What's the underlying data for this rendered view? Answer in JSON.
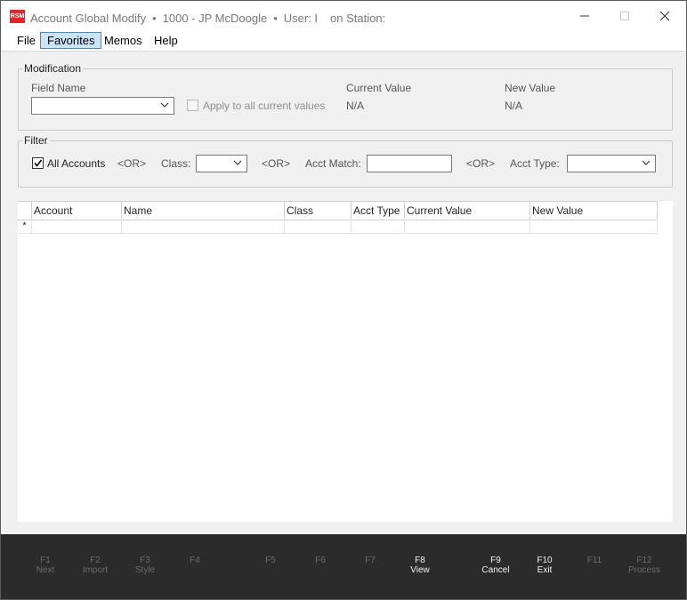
{
  "window": {
    "app_name": "Account Global Modify",
    "separator": "•",
    "client": "1000 - JP McDoogle",
    "user_label": "User: I",
    "station_label": "on Station:"
  },
  "menu": [
    "File",
    "Favorites",
    "Memos",
    "Help"
  ],
  "modification": {
    "legend": "Modification",
    "field_name_label": "Field Name",
    "field_name_value": "",
    "apply_all_label": "Apply to all current values",
    "current_value_label": "Current Value",
    "current_value": "N/A",
    "new_value_label": "New Value",
    "new_value": "N/A"
  },
  "filter": {
    "legend": "Filter",
    "all_accounts_label": "All Accounts",
    "all_accounts_checked": true,
    "or_text": "<OR>",
    "class_label": "Class:",
    "class_value": "",
    "acct_match_label": "Acct Match:",
    "acct_match_value": "",
    "acct_type_label": "Acct Type:",
    "acct_type_value": ""
  },
  "grid": {
    "columns": [
      "Account",
      "Name",
      "Class",
      "Acct Type",
      "Current Value",
      "New Value"
    ],
    "new_row_marker": "*"
  },
  "function_keys": [
    {
      "key": "F1",
      "label": "Next",
      "enabled": false
    },
    {
      "key": "F2",
      "label": "Import",
      "enabled": false
    },
    {
      "key": "F3",
      "label": "Style",
      "enabled": false
    },
    {
      "key": "F4",
      "label": "",
      "enabled": false
    },
    {
      "key": "F5",
      "label": "",
      "enabled": false
    },
    {
      "key": "F6",
      "label": "",
      "enabled": false
    },
    {
      "key": "F7",
      "label": "",
      "enabled": false
    },
    {
      "key": "F8",
      "label": "View",
      "enabled": true
    },
    {
      "key": "F9",
      "label": "Cancel",
      "enabled": true
    },
    {
      "key": "F10",
      "label": "Exit",
      "enabled": true
    },
    {
      "key": "F11",
      "label": "",
      "enabled": false
    },
    {
      "key": "F12",
      "label": "Process",
      "enabled": false
    }
  ],
  "colors": {
    "brand": "#e3262d",
    "menu_highlight": "#cce4f7",
    "function_bar": "#2b2b2b"
  }
}
